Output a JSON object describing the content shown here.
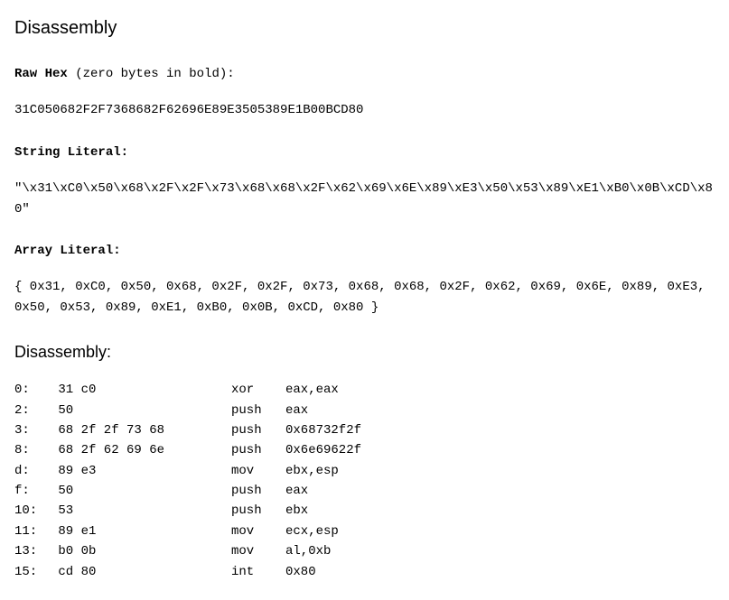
{
  "title": "Disassembly",
  "raw_hex": {
    "label": "Raw Hex",
    "suffix": " (zero bytes in bold):",
    "value": "31C050682F2F7368682F62696E89E3505389E1B00BCD80"
  },
  "string_literal": {
    "label": "String Literal:",
    "value": "\"\\x31\\xC0\\x50\\x68\\x2F\\x2F\\x73\\x68\\x68\\x2F\\x62\\x69\\x6E\\x89\\xE3\\x50\\x53\\x89\\xE1\\xB0\\x0B\\xCD\\x80\""
  },
  "array_literal": {
    "label": "Array Literal:",
    "value": "{ 0x31, 0xC0, 0x50, 0x68, 0x2F, 0x2F, 0x73, 0x68, 0x68, 0x2F, 0x62, 0x69, 0x6E, 0x89, 0xE3, 0x50, 0x53, 0x89, 0xE1, 0xB0, 0x0B, 0xCD, 0x80 }"
  },
  "disassembly": {
    "label": "Disassembly:",
    "rows": [
      {
        "offset": "0:",
        "bytes": "31 c0",
        "mnemonic": "xor",
        "operands": "eax,eax"
      },
      {
        "offset": "2:",
        "bytes": "50",
        "mnemonic": "push",
        "operands": "eax"
      },
      {
        "offset": "3:",
        "bytes": "68 2f 2f 73 68",
        "mnemonic": "push",
        "operands": "0x68732f2f"
      },
      {
        "offset": "8:",
        "bytes": "68 2f 62 69 6e",
        "mnemonic": "push",
        "operands": "0x6e69622f"
      },
      {
        "offset": "d:",
        "bytes": "89 e3",
        "mnemonic": "mov",
        "operands": "ebx,esp"
      },
      {
        "offset": "f:",
        "bytes": "50",
        "mnemonic": "push",
        "operands": "eax"
      },
      {
        "offset": "10:",
        "bytes": "53",
        "mnemonic": "push",
        "operands": "ebx"
      },
      {
        "offset": "11:",
        "bytes": "89 e1",
        "mnemonic": "mov",
        "operands": "ecx,esp"
      },
      {
        "offset": "13:",
        "bytes": "b0 0b",
        "mnemonic": "mov",
        "operands": "al,0xb"
      },
      {
        "offset": "15:",
        "bytes": "cd 80",
        "mnemonic": "int",
        "operands": "0x80"
      }
    ]
  }
}
